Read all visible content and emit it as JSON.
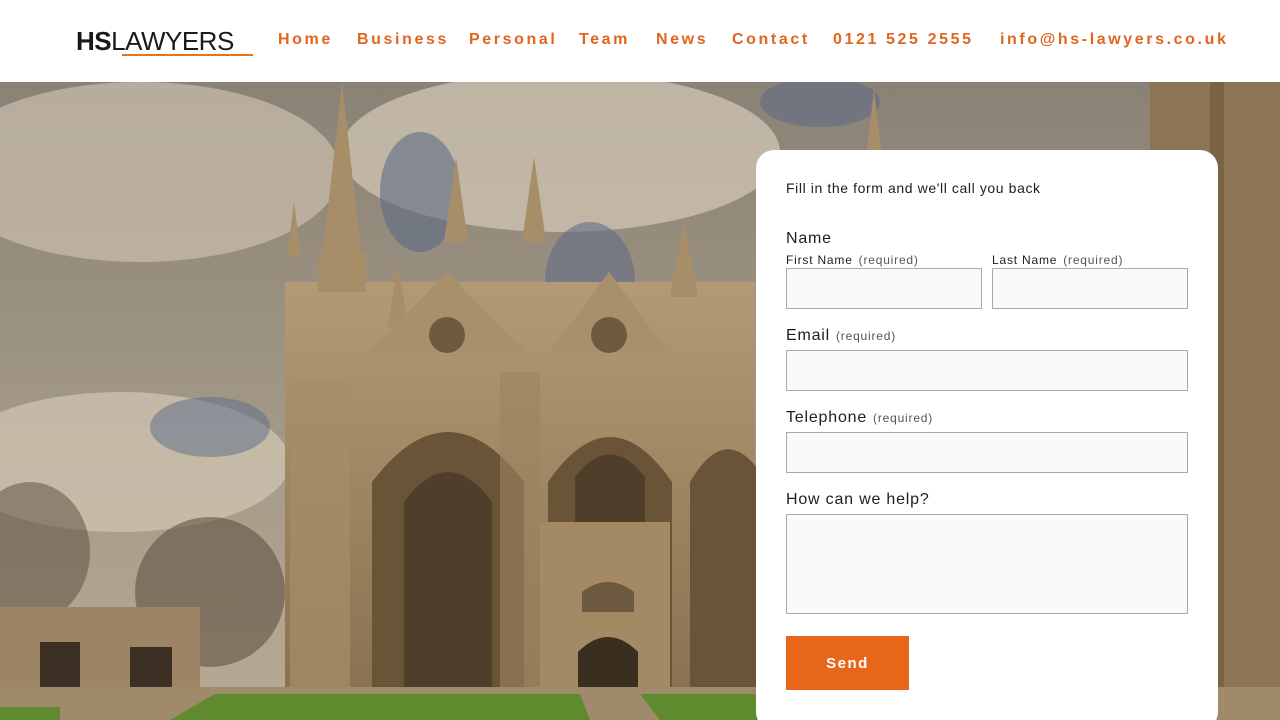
{
  "logo": {
    "bold": "HS",
    "light": "LAWYERS"
  },
  "nav": {
    "home": "Home",
    "business": "Business",
    "personal": "Personal",
    "team": "Team",
    "news": "News",
    "contact": "Contact",
    "phone": "0121 525 2555",
    "email": "info@hs-lawyers.co.uk"
  },
  "colors": {
    "accent": "#e8661a",
    "nav_text": "#e0661e"
  },
  "form": {
    "intro": "Fill in the form and we'll call you back",
    "name_label": "Name",
    "first_name_label": "First Name",
    "last_name_label": "Last Name",
    "email_label": "Email",
    "telephone_label": "Telephone",
    "help_label": "How can we help?",
    "required": "(required)",
    "first_name_value": "",
    "last_name_value": "",
    "email_value": "",
    "telephone_value": "",
    "help_value": "",
    "send_label": "Send"
  }
}
